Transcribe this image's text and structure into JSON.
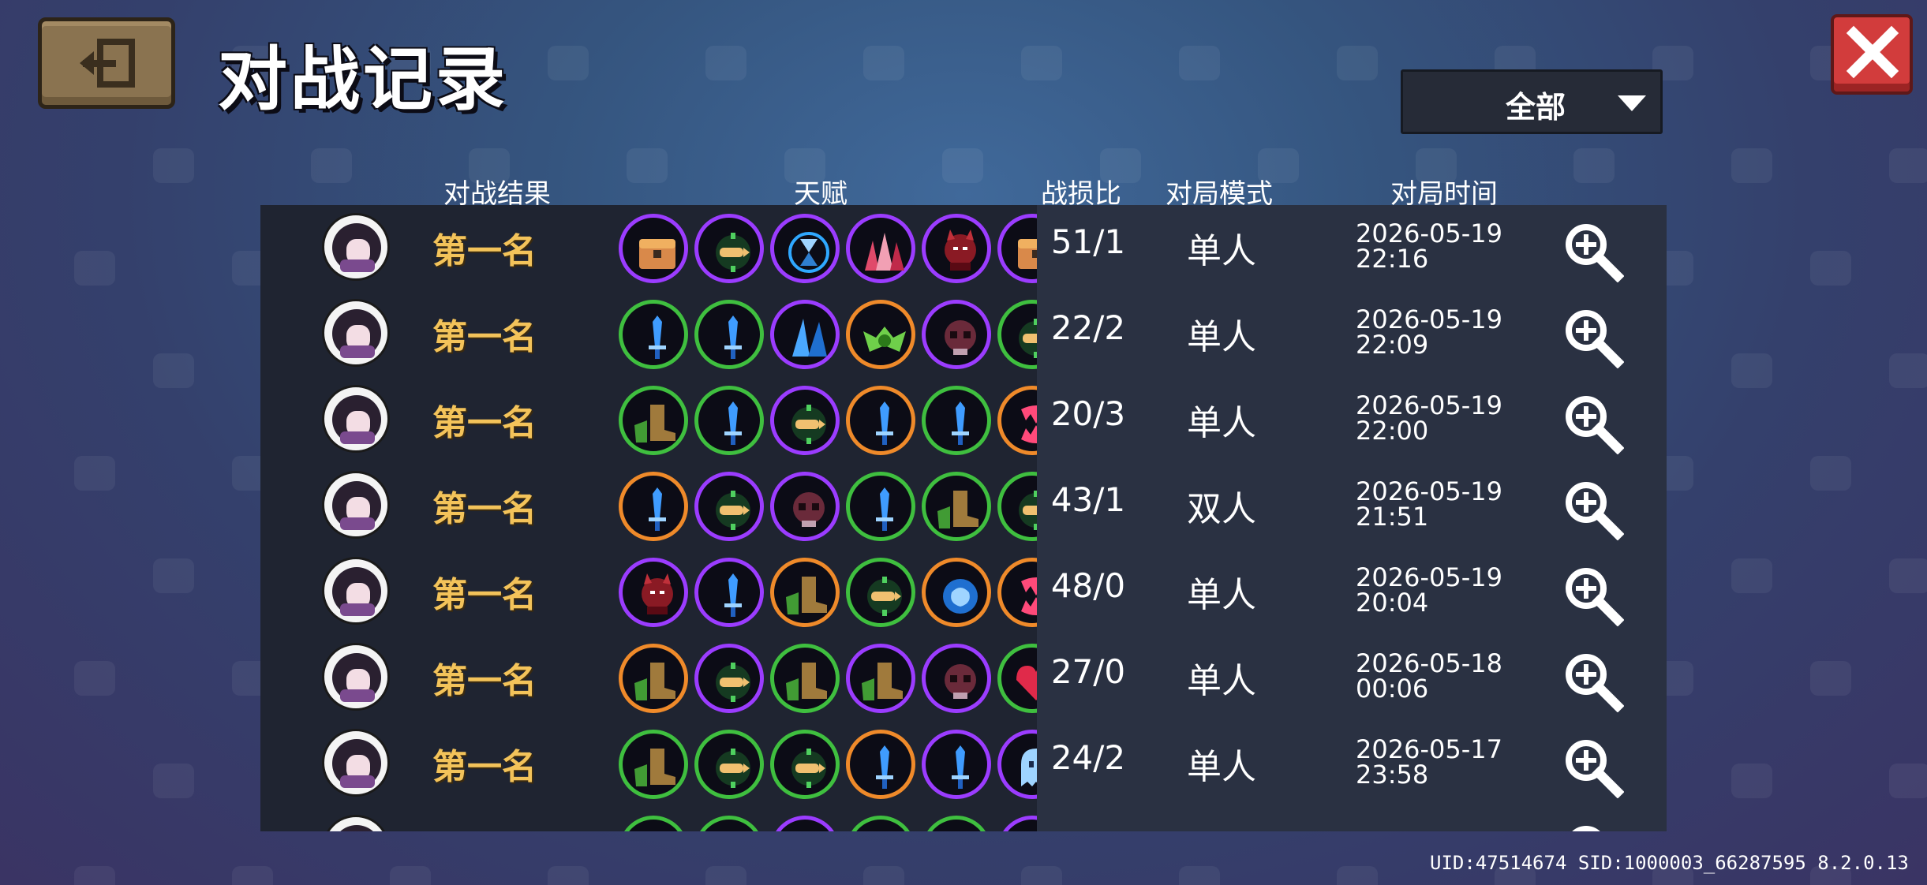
{
  "header": {
    "title": "对战记录",
    "back_icon": "exit-icon",
    "close_icon": "close-icon"
  },
  "filter": {
    "selected": "全部",
    "icon": "dropdown-arrow-icon"
  },
  "columns": {
    "result": "对战结果",
    "talents": "天赋",
    "ratio": "战损比",
    "mode": "对局模式",
    "time": "对局时间"
  },
  "colors": {
    "purple_rim": "#9b3cff",
    "green_rim": "#3fbf3f",
    "orange_rim": "#ef8a2a",
    "result_gold": "#f3c35a",
    "close_red": "#d23c3c"
  },
  "rows": [
    {
      "result": "第一名",
      "ratio": "51/1",
      "mode": "单人",
      "date": "2026-05-19",
      "time": "22:16",
      "detail_icon": "zoom-in-icon",
      "talents": [
        {
          "icon": "treasure-chest-icon",
          "rim": "purple"
        },
        {
          "icon": "bullet-icon",
          "rim": "purple"
        },
        {
          "icon": "hourglass-icon",
          "rim": "purple"
        },
        {
          "icon": "spikes-icon",
          "rim": "purple"
        },
        {
          "icon": "demon-icon",
          "rim": "purple"
        },
        {
          "icon": "treasure-chest-icon",
          "rim": "purple"
        }
      ]
    },
    {
      "result": "第一名",
      "ratio": "22/2",
      "mode": "单人",
      "date": "2026-05-19",
      "time": "22:09",
      "detail_icon": "zoom-in-icon",
      "talents": [
        {
          "icon": "dagger-icon",
          "rim": "green"
        },
        {
          "icon": "dagger-icon",
          "rim": "green"
        },
        {
          "icon": "blade-icon",
          "rim": "purple"
        },
        {
          "icon": "bat-icon",
          "rim": "orange"
        },
        {
          "icon": "skull-icon",
          "rim": "purple"
        },
        {
          "icon": "bullet-icon",
          "rim": "green"
        }
      ]
    },
    {
      "result": "第一名",
      "ratio": "20/3",
      "mode": "单人",
      "date": "2026-05-19",
      "time": "22:00",
      "detail_icon": "zoom-in-icon",
      "talents": [
        {
          "icon": "boot-icon",
          "rim": "green"
        },
        {
          "icon": "dagger-icon",
          "rim": "green"
        },
        {
          "icon": "bullet-icon",
          "rim": "purple"
        },
        {
          "icon": "dagger-icon",
          "rim": "orange"
        },
        {
          "icon": "dagger-icon",
          "rim": "green"
        },
        {
          "icon": "fang-icon",
          "rim": "orange"
        }
      ]
    },
    {
      "result": "第一名",
      "ratio": "43/1",
      "mode": "双人",
      "date": "2026-05-19",
      "time": "21:51",
      "detail_icon": "zoom-in-icon",
      "talents": [
        {
          "icon": "dagger-icon",
          "rim": "orange"
        },
        {
          "icon": "bullet-icon",
          "rim": "purple"
        },
        {
          "icon": "skull-icon",
          "rim": "purple"
        },
        {
          "icon": "dagger-icon",
          "rim": "green"
        },
        {
          "icon": "boot-icon",
          "rim": "green"
        },
        {
          "icon": "bullet-icon",
          "rim": "green"
        }
      ]
    },
    {
      "result": "第一名",
      "ratio": "48/0",
      "mode": "单人",
      "date": "2026-05-19",
      "time": "20:04",
      "detail_icon": "zoom-in-icon",
      "talents": [
        {
          "icon": "demon-icon",
          "rim": "purple"
        },
        {
          "icon": "dagger-icon",
          "rim": "purple"
        },
        {
          "icon": "boot-icon",
          "rim": "orange"
        },
        {
          "icon": "bullet-icon",
          "rim": "green"
        },
        {
          "icon": "brain-icon",
          "rim": "orange"
        },
        {
          "icon": "fang-icon",
          "rim": "orange"
        }
      ]
    },
    {
      "result": "第一名",
      "ratio": "27/0",
      "mode": "单人",
      "date": "2026-05-18",
      "time": "00:06",
      "detail_icon": "zoom-in-icon",
      "talents": [
        {
          "icon": "boot-icon",
          "rim": "orange"
        },
        {
          "icon": "bullet-icon",
          "rim": "purple"
        },
        {
          "icon": "boot-icon",
          "rim": "green"
        },
        {
          "icon": "boot-icon",
          "rim": "purple"
        },
        {
          "icon": "skull-icon",
          "rim": "purple"
        },
        {
          "icon": "heart-icon",
          "rim": "green"
        }
      ]
    },
    {
      "result": "第一名",
      "ratio": "24/2",
      "mode": "单人",
      "date": "2026-05-17",
      "time": "23:58",
      "detail_icon": "zoom-in-icon",
      "talents": [
        {
          "icon": "boot-icon",
          "rim": "green"
        },
        {
          "icon": "bullet-icon",
          "rim": "green"
        },
        {
          "icon": "bullet-icon",
          "rim": "green"
        },
        {
          "icon": "dagger-icon",
          "rim": "orange"
        },
        {
          "icon": "dagger-icon",
          "rim": "purple"
        },
        {
          "icon": "ghost-icon",
          "rim": "purple"
        }
      ]
    },
    {
      "result": "",
      "ratio": "",
      "mode": "",
      "date": "",
      "time": "",
      "detail_icon": "zoom-in-icon",
      "talents": [
        {
          "icon": "dagger-icon",
          "rim": "green"
        },
        {
          "icon": "bullet-icon",
          "rim": "green"
        },
        {
          "icon": "blade-icon",
          "rim": "purple"
        },
        {
          "icon": "bullet-icon",
          "rim": "green"
        },
        {
          "icon": "dagger-icon",
          "rim": "green"
        },
        {
          "icon": "demon-icon",
          "rim": "purple"
        }
      ]
    }
  ],
  "footer": {
    "ids": "UID:47514674 SID:1000003_66287595 8.2.0.13"
  }
}
